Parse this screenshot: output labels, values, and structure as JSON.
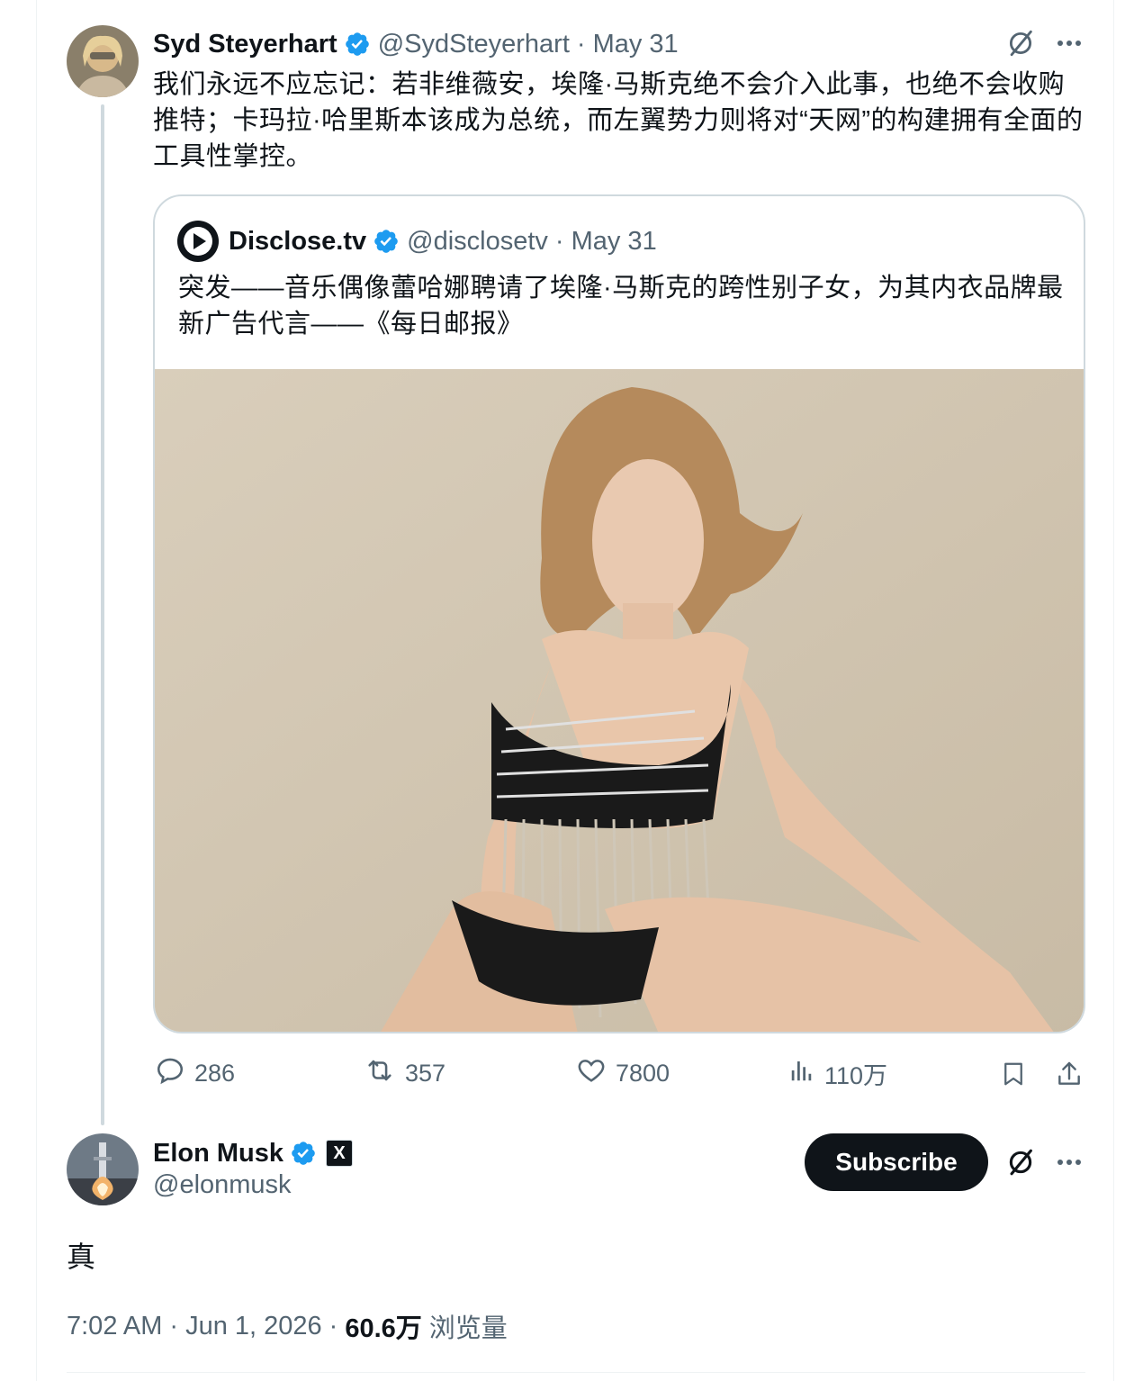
{
  "parent_tweet": {
    "display_name": "Syd Steyerhart",
    "handle": "@SydSteyerhart",
    "separator": "·",
    "date": "May 31",
    "text": "我们永远不应忘记：若非维薇安，埃隆·马斯克绝不会介入此事，也绝不会收购推特；卡玛拉·哈里斯本该成为总统，而左翼势力则将对“天网”的构建拥有全面的工具性掌控。",
    "quote": {
      "display_name": "Disclose.tv",
      "handle": "@disclosetv",
      "separator": "·",
      "date": "May 31",
      "text": "突发——音乐偶像蕾哈娜聘请了埃隆·马斯克的跨性别子女，为其内衣品牌最新广告代言——《每日邮报》"
    },
    "actions": {
      "replies": "286",
      "reposts": "357",
      "likes": "7800",
      "views": "110万"
    }
  },
  "main_tweet": {
    "display_name": "Elon Musk",
    "handle": "@elonmusk",
    "affiliate_badge": "X",
    "subscribe_label": "Subscribe",
    "text": "真",
    "time": "7:02 AM",
    "separator": "·",
    "date": "Jun 1, 2026",
    "views_count": "60.6万",
    "views_label": "浏览量"
  },
  "colors": {
    "verified_blue": "#1d9bf0",
    "secondary_text": "#536471",
    "primary_text": "#0f1419",
    "border": "#cfd9de"
  },
  "icons": [
    "verified-badge-icon",
    "grok-icon",
    "more-icon",
    "disclose-logo-icon",
    "reply-icon",
    "repost-icon",
    "like-icon",
    "views-icon",
    "bookmark-icon",
    "share-icon",
    "x-logo-icon"
  ]
}
